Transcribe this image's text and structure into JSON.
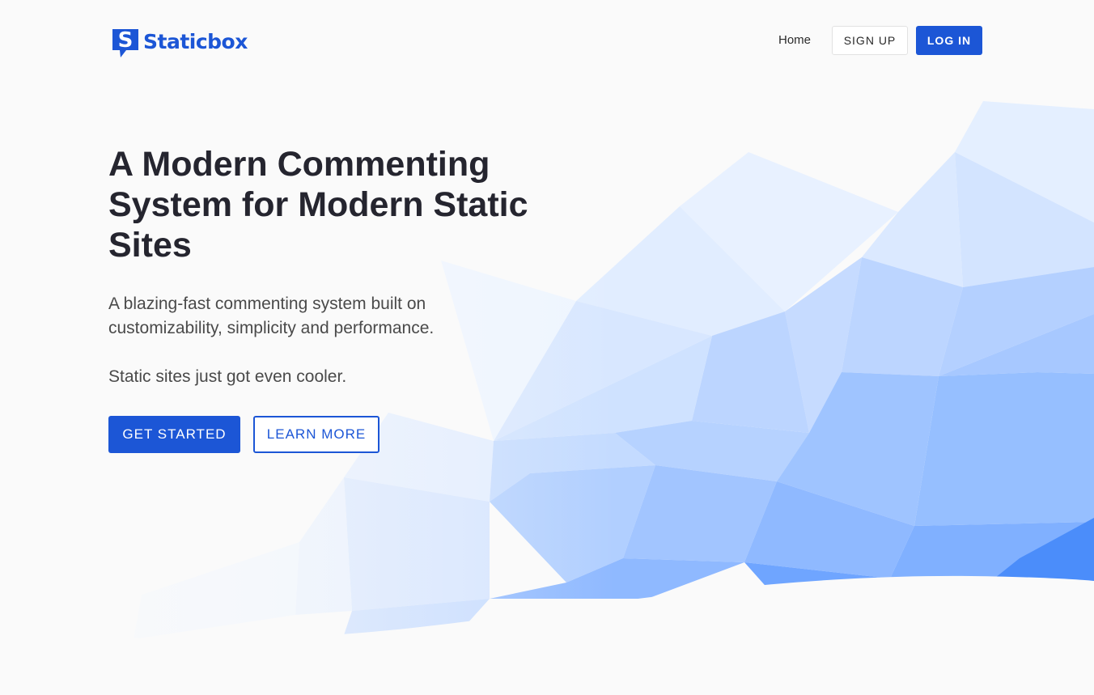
{
  "brand": {
    "name": "Staticbox",
    "logo_icon": "speech-bubble-s-icon"
  },
  "nav": {
    "home": "Home",
    "signup": "SIGN UP",
    "login": "LOG IN"
  },
  "hero": {
    "title": "A Modern Commenting System for Modern Static Sites",
    "subtitle": "A blazing-fast commenting system built on customizability, simplicity and performance.",
    "tagline": "Static sites just got even cooler.",
    "primary_cta": "GET STARTED",
    "secondary_cta": "LEARN MORE"
  },
  "colors": {
    "accent": "#1c56d6",
    "heading": "#25252f",
    "body_text": "#4a4a4a",
    "background": "#fafafa"
  }
}
